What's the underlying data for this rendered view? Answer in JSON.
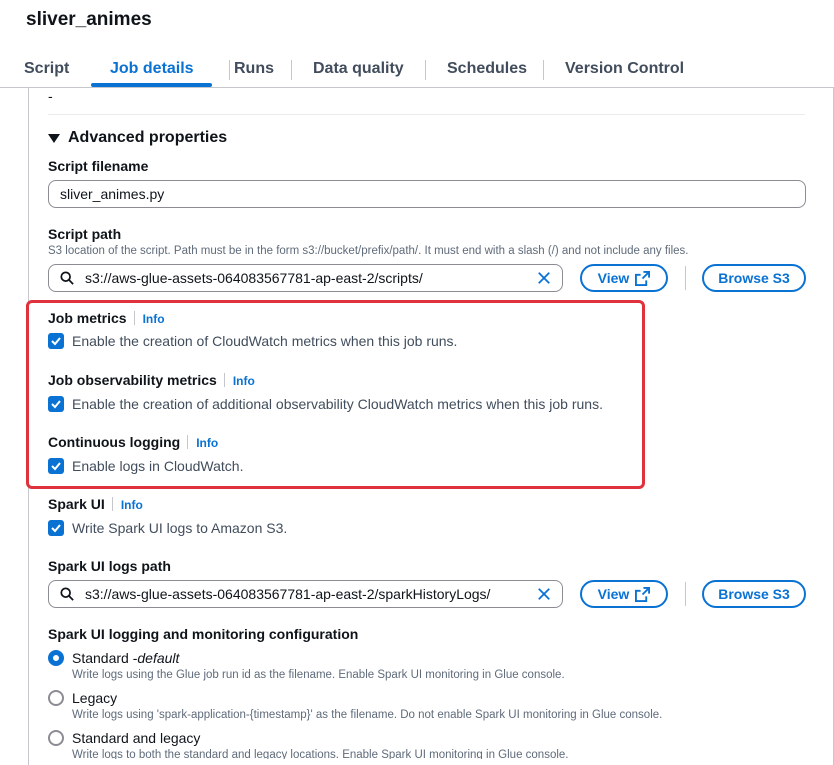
{
  "job": {
    "title": "sliver_animes"
  },
  "tabs": [
    {
      "label": "Script"
    },
    {
      "label": "Job details"
    },
    {
      "label": "Runs"
    },
    {
      "label": "Data quality"
    },
    {
      "label": "Schedules"
    },
    {
      "label": "Version Control"
    }
  ],
  "active_tab": "Job details",
  "top_value": "-",
  "advanced": {
    "title": "Advanced properties",
    "script_filename": {
      "label": "Script filename",
      "value": "sliver_animes.py"
    },
    "script_path": {
      "label": "Script path",
      "description": "S3 location of the script. Path must be in the form s3://bucket/prefix/path/. It must end with a slash (/) and not include any files.",
      "value": "s3://aws-glue-assets-064083567781-ap-east-2/scripts/",
      "view_label": "View",
      "browse_label": "Browse S3"
    },
    "job_metrics": {
      "label": "Job metrics",
      "info": "Info",
      "checkbox_label": "Enable the creation of CloudWatch metrics when this job runs.",
      "checked": true
    },
    "observability": {
      "label": "Job observability metrics",
      "info": "Info",
      "checkbox_label": "Enable the creation of additional observability CloudWatch metrics when this job runs.",
      "checked": true
    },
    "continuous_logging": {
      "label": "Continuous logging",
      "info": "Info",
      "checkbox_label": "Enable logs in CloudWatch.",
      "checked": true
    },
    "spark_ui": {
      "label": "Spark UI",
      "info": "Info",
      "checkbox_label": "Write Spark UI logs to Amazon S3.",
      "checked": true
    },
    "spark_logs_path": {
      "label": "Spark UI logs path",
      "value": "s3://aws-glue-assets-064083567781-ap-east-2/sparkHistoryLogs/",
      "view_label": "View",
      "browse_label": "Browse S3"
    },
    "spark_config": {
      "label": "Spark UI logging and monitoring configuration",
      "options": [
        {
          "label": "Standard - ",
          "suffix": "default",
          "description": "Write logs using the Glue job run id as the filename. Enable Spark UI monitoring in Glue console.",
          "selected": true
        },
        {
          "label": "Legacy",
          "description": "Write logs using 'spark-application-{timestamp}' as the filename. Do not enable Spark UI monitoring in Glue console.",
          "selected": false
        },
        {
          "label": "Standard and legacy",
          "description": "Write logs to both the standard and legacy locations. Enable Spark UI monitoring in Glue console.",
          "selected": false
        }
      ]
    }
  },
  "colors": {
    "accent": "#0972d3",
    "highlight": "#e0323d",
    "text": "#0f141a",
    "muted": "#5f6b7a"
  }
}
